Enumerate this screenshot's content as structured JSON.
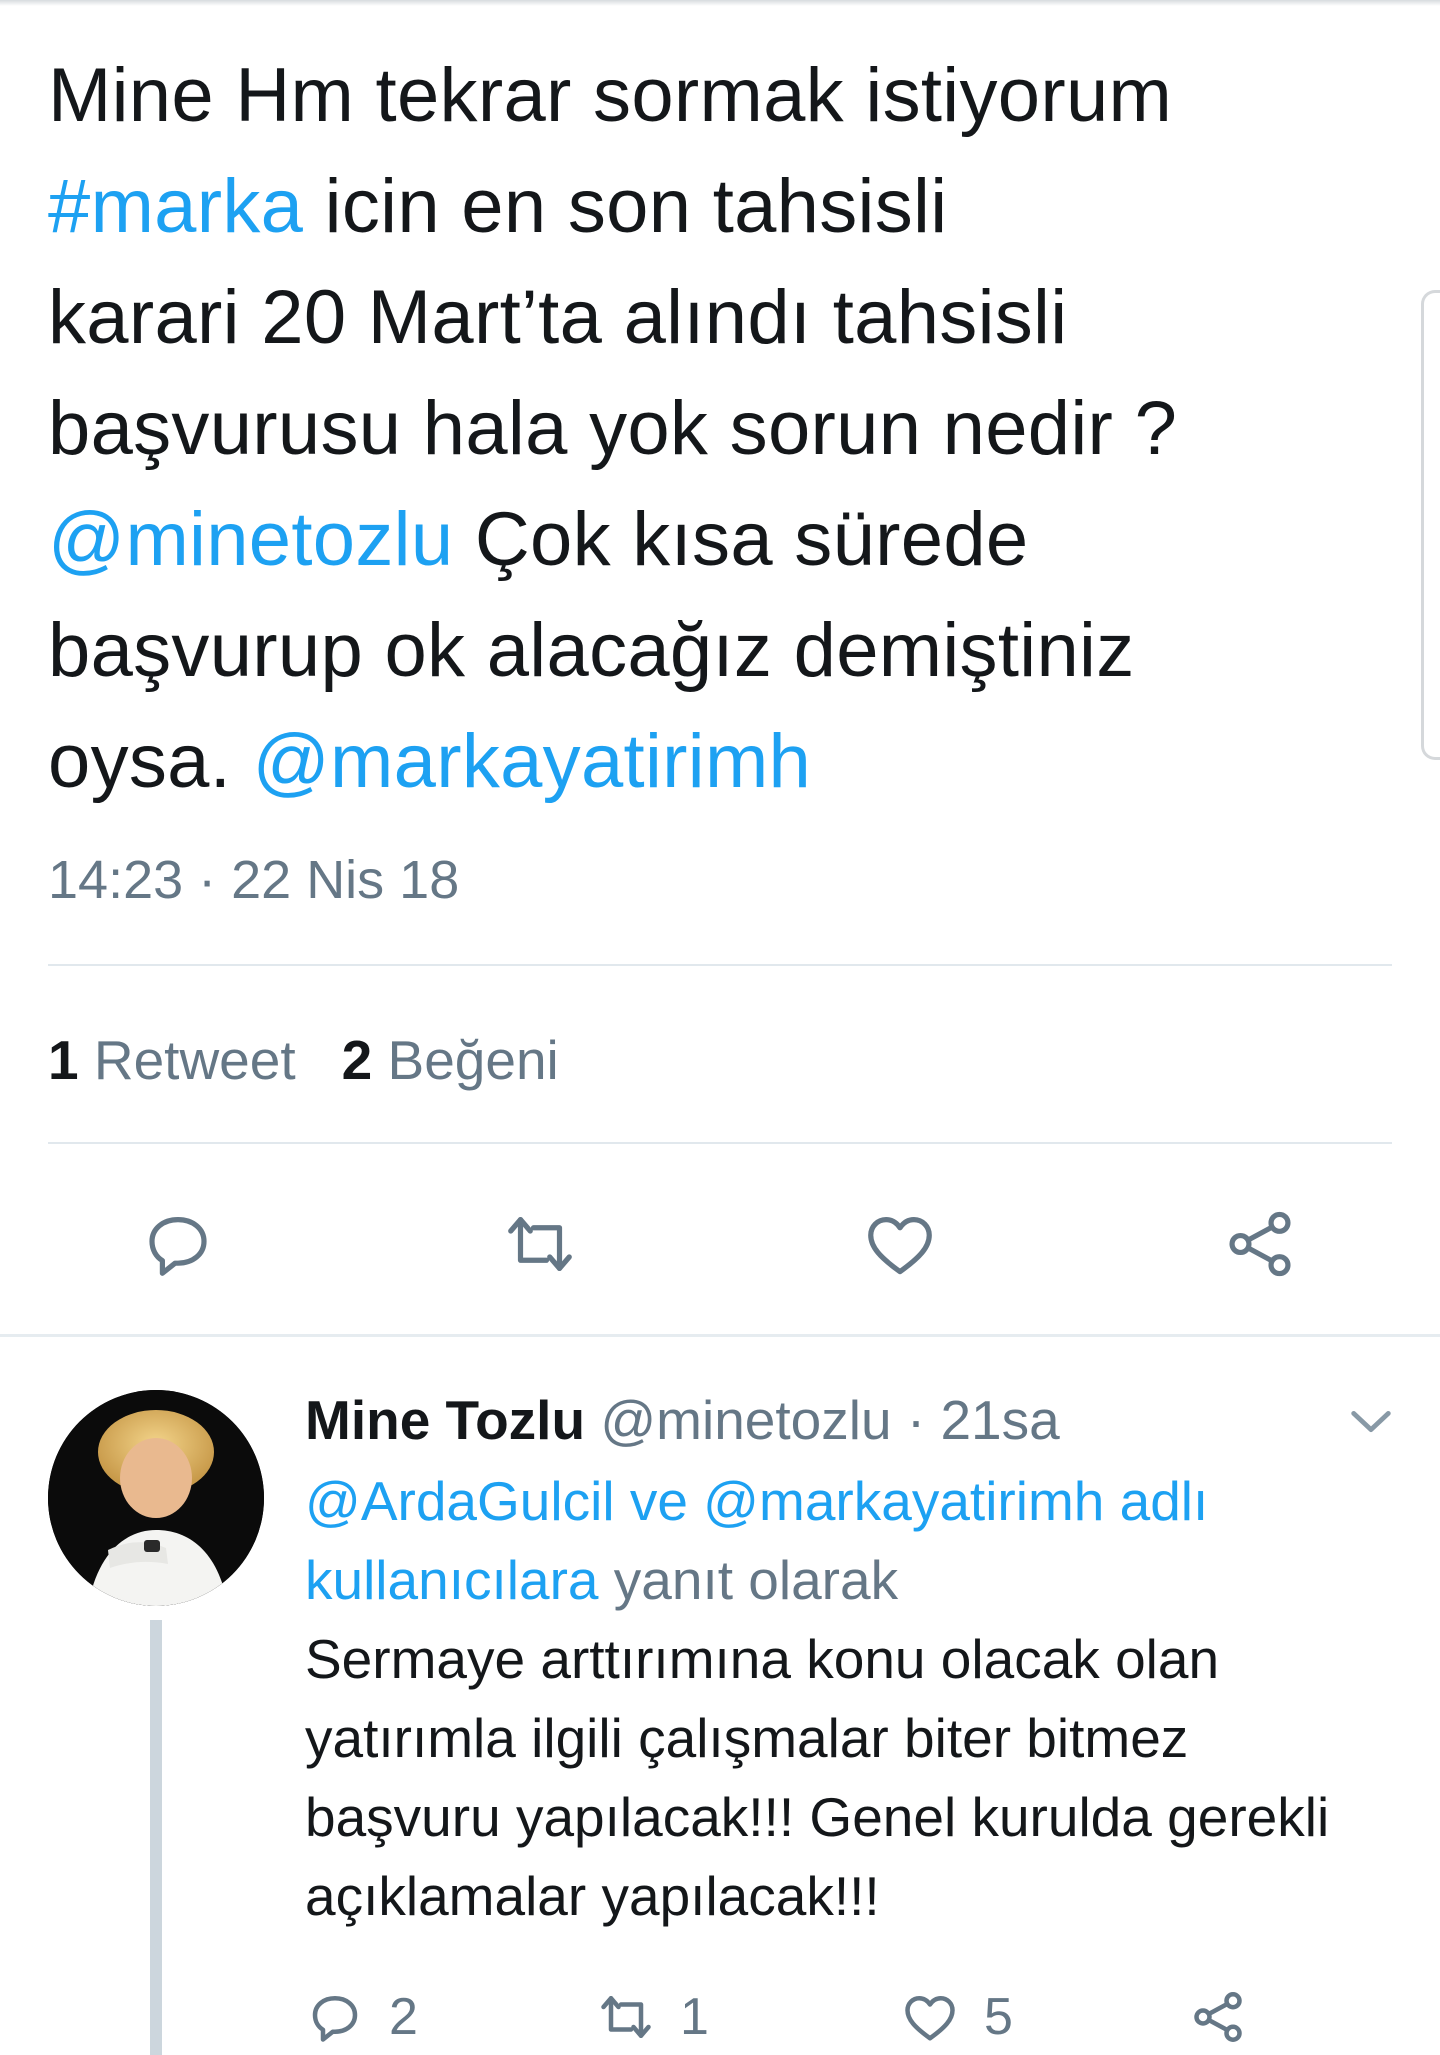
{
  "tweet": {
    "segments": [
      {
        "t": "Mine Hm tekrar sormak istiyorum",
        "link": false
      },
      {
        "t": "\n",
        "link": false
      },
      {
        "t": "#marka",
        "link": true
      },
      {
        "t": " icin en son tahsisli",
        "link": false
      },
      {
        "t": "\n",
        "link": false
      },
      {
        "t": "karari 20 Mart’ta alındı tahsisli",
        "link": false
      },
      {
        "t": "\n",
        "link": false
      },
      {
        "t": "başvurusu hala yok sorun nedir ?",
        "link": false
      },
      {
        "t": "\n",
        "link": false
      },
      {
        "t": "@minetozlu",
        "link": true
      },
      {
        "t": " Çok kısa sürede",
        "link": false
      },
      {
        "t": "\n",
        "link": false
      },
      {
        "t": "başvurup ok alacağız demiştiniz",
        "link": false
      },
      {
        "t": "\n",
        "link": false
      },
      {
        "t": "oysa. ",
        "link": false
      },
      {
        "t": "@markayatirimh",
        "link": true
      }
    ],
    "timestamp": "14:23 · 22 Nis 18",
    "retweet_count": "1",
    "retweet_label": "Retweet",
    "like_count": "2",
    "like_label": "Beğeni"
  },
  "reply": {
    "name": "Mine Tozlu",
    "handle": "@minetozlu",
    "separator": " · ",
    "time": "21sa",
    "context_links": "@ArdaGulcil ve @markayatirimh adlı kullanıcılara",
    "context_rest": " yanıt olarak",
    "text": "Sermaye arttırımına konu olacak olan yatırımla ilgili çalışmalar biter bitmez başvuru yapılacak!!! Genel kurulda gerekli açıklamalar yapılacak!!!",
    "reply_count": "2",
    "retweet_count": "1",
    "like_count": "5"
  },
  "colors": {
    "link": "#1da1f2",
    "secondary_text": "#657786",
    "primary_text": "#14171a",
    "divider": "#e1e8ed"
  },
  "icons": [
    "reply-icon",
    "retweet-icon",
    "like-icon",
    "share-icon",
    "chevron-down-icon"
  ]
}
